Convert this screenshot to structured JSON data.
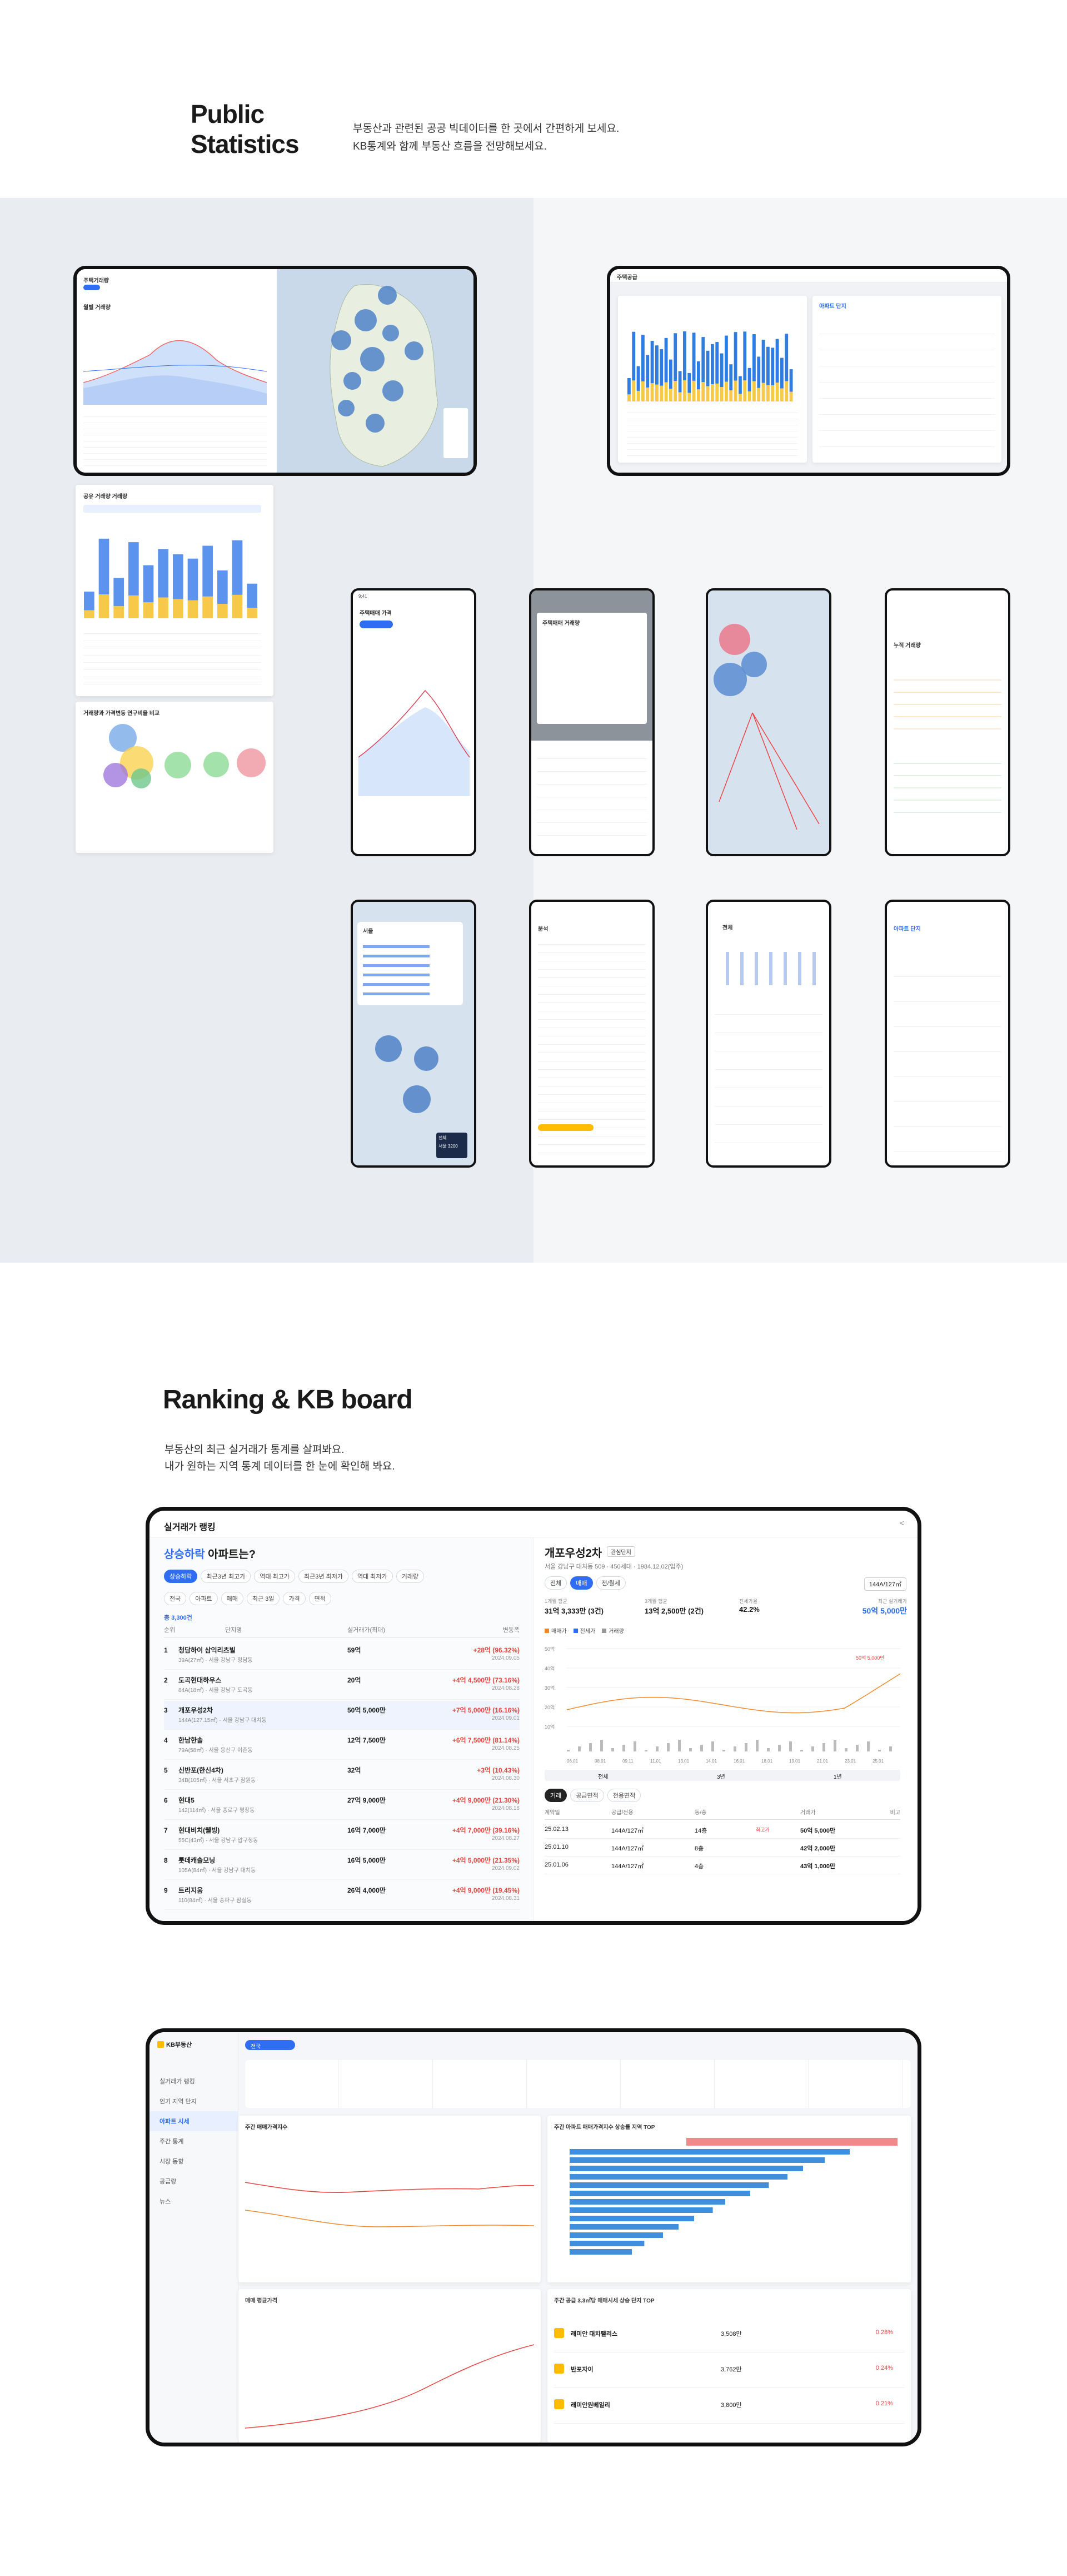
{
  "hero": {
    "title": "Public\nStatistics",
    "desc_line1": "부동산과 관련된 공공 빅데이터를 한 곳에서 간편하게 보세요.",
    "desc_line2": "KB통계와 함께 부동산 흐름을 전망해보세요."
  },
  "screens": {
    "tablet1_title": "주택거래량",
    "tablet2_title": "주택공급",
    "apt_panel_title": "아파트 단지",
    "panel_left_title": "월별 거래량",
    "card1_title": "공유 거래량 거래량",
    "card2_title": "거래량과 가격변동 연구비율 비교",
    "phone1_title": "주택매매 가격",
    "phone2_title": "주택매매 거래량",
    "phone4_title": "누적 거래량",
    "phone5_title": "서울",
    "phone6_title": "분석",
    "phone7_title": "전체",
    "phone8_title": "아파트 단지",
    "time": "9:41",
    "seoul_map_tags": [
      "전체",
      "서울 3200"
    ]
  },
  "ranking": {
    "section_title": "Ranking & KB board",
    "desc_line1": "부동산의 최근 실거래가 통계를 살펴봐요.",
    "desc_line2": "내가 원하는 지역 통계 데이터를 한 눈에 확인해 봐요.",
    "window_title": "실거래가 랭킹",
    "question_prefix": "상승하락",
    "question_suffix": " 아파트는?",
    "tabs": [
      "상승하락",
      "최근3년 최고가",
      "역대 최고가",
      "최근3년 최저가",
      "역대 최저가",
      "거래량"
    ],
    "filters": [
      "전국",
      "아파트",
      "매매",
      "최근 3일",
      "가격",
      "면적"
    ],
    "count_text": "총 3,300건",
    "col_headers": [
      "순위",
      "단지명",
      "실거래가(최대)",
      "변동폭"
    ],
    "rows": [
      {
        "rank": "1",
        "name": "청담하이 삼익리츠빌",
        "sub": "39A(27㎡) · 서울 강남구 청담동",
        "price": "59억",
        "change": "+28억 (96.32%)",
        "date": "2024.09.05"
      },
      {
        "rank": "2",
        "name": "도곡현대하우스",
        "sub": "84A(18㎡) · 서울 강남구 도곡동",
        "price": "20억",
        "change": "+4억 4,500만 (73.16%)",
        "date": "2024.08.28"
      },
      {
        "rank": "3",
        "name": "개포우성2차",
        "sub": "144A(127.15㎡) · 서울 강남구 대치동",
        "price": "50억 5,000만",
        "change": "+7억 5,000만 (16.16%)",
        "date": "2024.09.01"
      },
      {
        "rank": "4",
        "name": "한남한솔",
        "sub": "79A(58㎡) · 서울 용산구 이촌동",
        "price": "12억 7,500만",
        "change": "+6억 7,500만 (81.14%)",
        "date": "2024.08.25"
      },
      {
        "rank": "5",
        "name": "신반포(한신4차)",
        "sub": "34B(105㎡) · 서울 서초구 잠원동",
        "price": "32억",
        "change": "+3억 (10.43%)",
        "date": "2024.08.30"
      },
      {
        "rank": "6",
        "name": "현대5",
        "sub": "142(114㎡) · 서울 종로구 평창동",
        "price": "27억 9,000만",
        "change": "+4억 9,000만 (21.30%)",
        "date": "2024.08.18"
      },
      {
        "rank": "7",
        "name": "현대비치(웰빙)",
        "sub": "55C(43㎡) · 서울 강남구 압구정동",
        "price": "16억 7,000만",
        "change": "+4억 7,000만 (39.16%)",
        "date": "2024.08.27"
      },
      {
        "rank": "8",
        "name": "롯데캐슬모닝",
        "sub": "105A(84㎡) · 서울 강남구 대치동",
        "price": "16억 5,000만",
        "change": "+4억 5,000만 (21.35%)",
        "date": "2024.09.02"
      },
      {
        "rank": "9",
        "name": "트리지움",
        "sub": "110(84㎡) · 서울 송파구 잠실동",
        "price": "26억 4,000만",
        "change": "+4억 9,000만 (19.45%)",
        "date": "2024.08.31"
      }
    ],
    "detail": {
      "title": "개포우성2차",
      "tag": "관심단지",
      "address": "서울 강남구 대치동 509 · 450세대 · 1984.12.02(입주)",
      "tabs": [
        "전체",
        "매매",
        "전/월세"
      ],
      "area_select": "144A/127㎡",
      "stats": [
        {
          "label": "1개월 평균",
          "value": "31억 3,333만 (3건)"
        },
        {
          "label": "3개월 평균",
          "value": "13억 2,500만 (2건)"
        },
        {
          "label": "전세가율",
          "value": "42.2%"
        },
        {
          "label": "최근 실거래가",
          "value": "50억 5,000만"
        }
      ],
      "legend": [
        "매매가",
        "전세가",
        "거래량"
      ],
      "period_tabs": [
        "전체",
        "3년",
        "1년"
      ],
      "table_tabs": [
        "거래",
        "공급면적",
        "전용면적"
      ],
      "table_headers": [
        "계약일",
        "공급/전용",
        "동/층",
        "거래가",
        "비고"
      ],
      "table_rows": [
        {
          "date": "25.02.13",
          "area": "144A/127㎡",
          "floor": "14층",
          "price": "50억 5,000만",
          "note": "최고가"
        },
        {
          "date": "25.01.10",
          "area": "144A/127㎡",
          "floor": "8층",
          "price": "42억 2,000만",
          "note": ""
        },
        {
          "date": "25.01.06",
          "area": "144A/127㎡",
          "floor": "4층",
          "price": "43억 1,000만",
          "note": ""
        }
      ],
      "y_ticks": [
        "50억",
        "40억",
        "30억",
        "20억",
        "10억"
      ],
      "x_ticks": [
        "06.01",
        "08.01",
        "09.11",
        "11.01",
        "13.01",
        "14.01",
        "16.01",
        "18.01",
        "19.01",
        "21.01",
        "23.01",
        "25.01"
      ],
      "label_high": "50억 5,000만"
    }
  },
  "board": {
    "logo": "KB부동산",
    "region": "전국",
    "nav": [
      "실거래가 랭킹",
      "인기 지역 단지",
      "아파트 시세",
      "주간 통계",
      "시장 동향",
      "공급량",
      "뉴스"
    ],
    "card1_title": "주간 매매가격지수",
    "card2_title": "주간 아파트 매매가격지수 상승률 지역 TOP",
    "card3_title": "매매 평균가격",
    "card4_title": "주간 공급 3.3㎡당 매매시세 상승 단지 TOP",
    "top_list": [
      {
        "name": "래미안 대치팰리스",
        "a": "3,508만",
        "b": "0.28%"
      },
      {
        "name": "반포자이",
        "a": "3,762만",
        "b": "0.24%"
      },
      {
        "name": "래미안원베일리",
        "a": "3,800만",
        "b": "0.21%"
      }
    ],
    "chart_bars": [
      0.9,
      0.82,
      0.75,
      0.7,
      0.64,
      0.58,
      0.5,
      0.46,
      0.4,
      0.35,
      0.3,
      0.24,
      0.2
    ]
  },
  "colors": {
    "accent": "#2f6ef2",
    "kb_yellow": "#ffbc00",
    "up": "#e8433f"
  }
}
